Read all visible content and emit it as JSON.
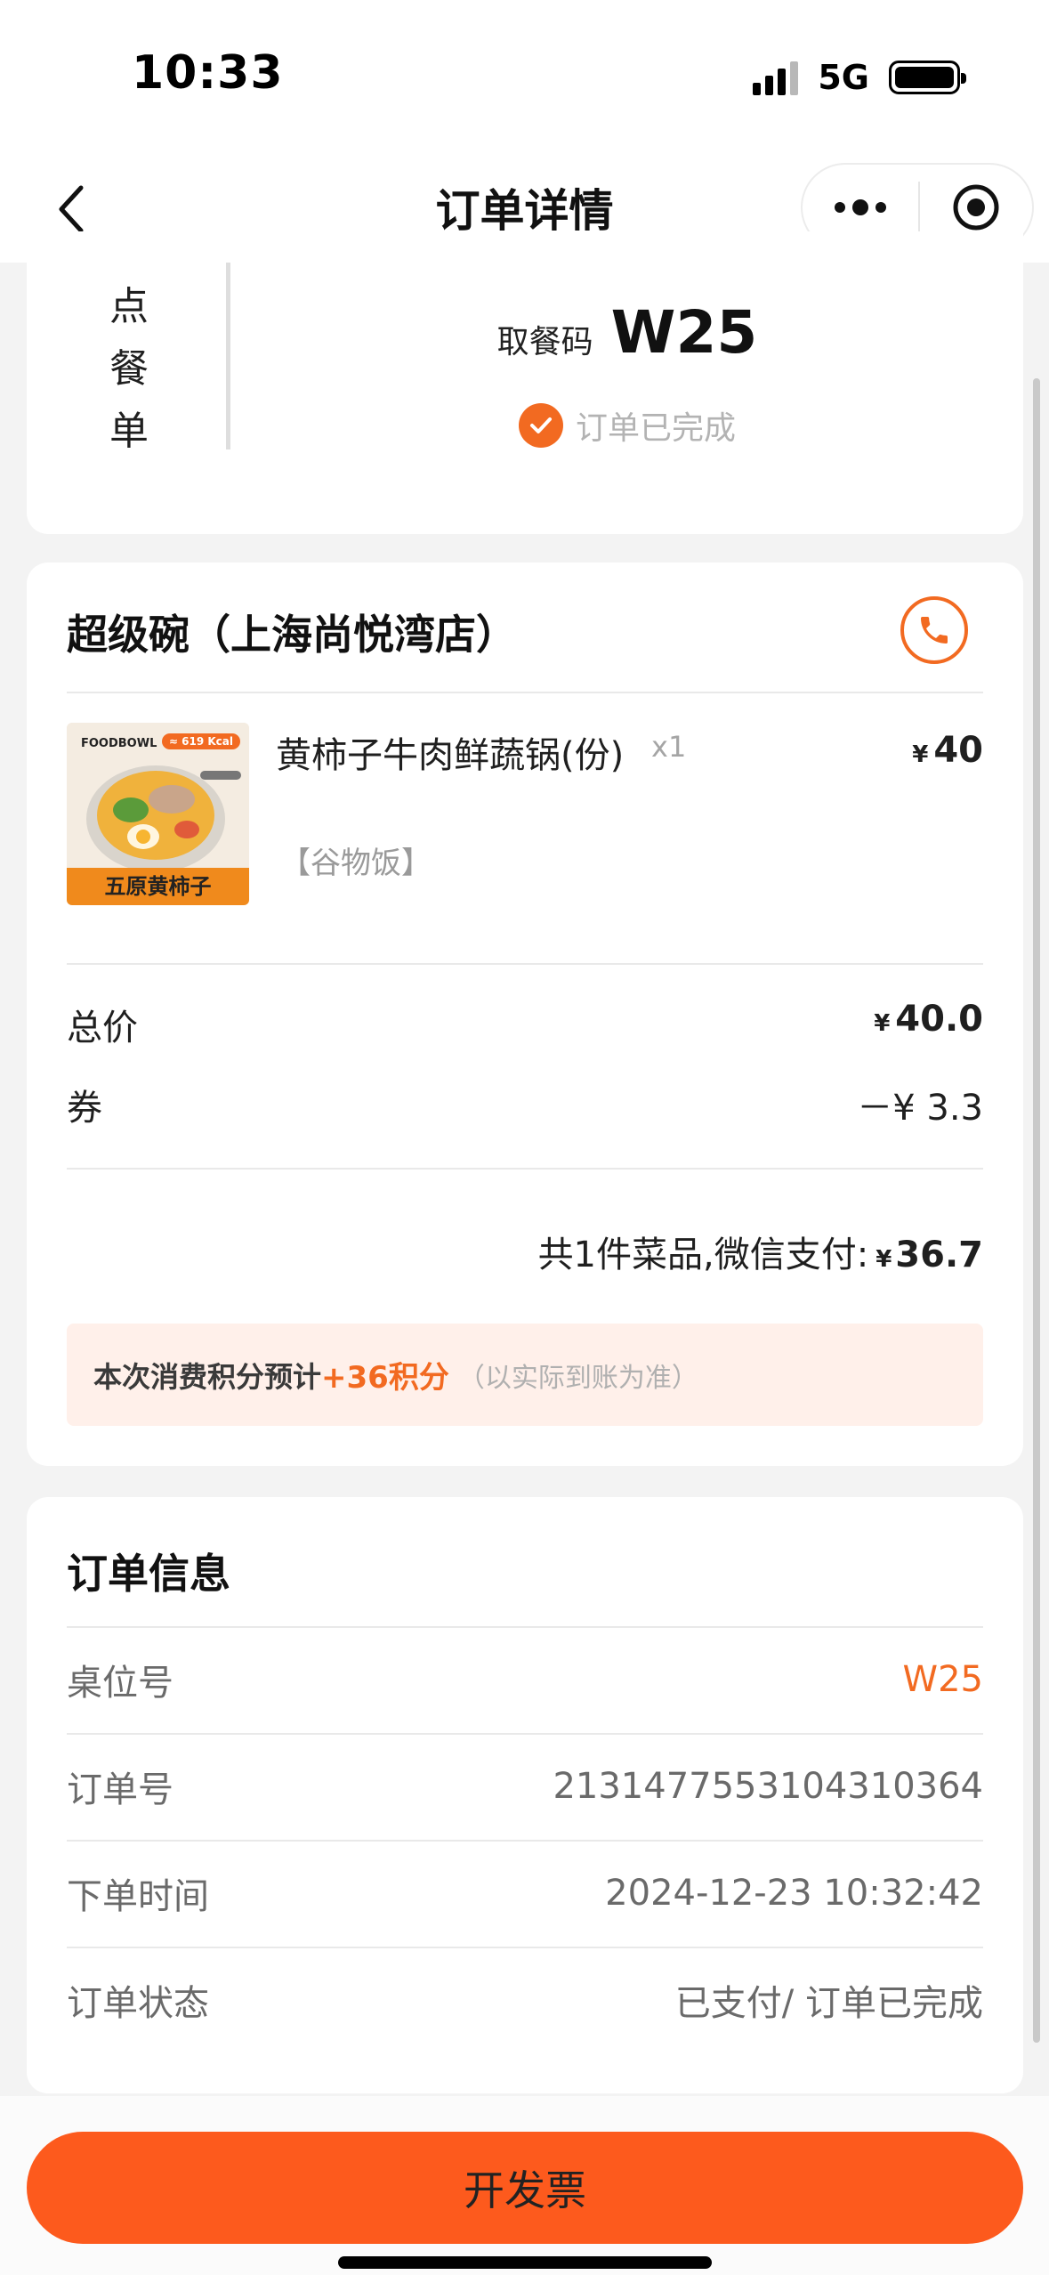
{
  "status_bar": {
    "time": "10:33",
    "network": "5G"
  },
  "nav": {
    "title": "订单详情"
  },
  "pickup": {
    "vertical_label": [
      "点",
      "餐",
      "单"
    ],
    "code_label": "取餐码",
    "code": "W25",
    "status": "订单已完成"
  },
  "order": {
    "store_name": "超级碗（上海尚悦湾店）",
    "item": {
      "image_brand": "FOODBOWL",
      "image_kcal": "≈ 619 Kcal",
      "image_banner": "五原黄柿子",
      "name": "黄柿子牛肉鲜蔬锅(份)",
      "tag": "【谷物饭】",
      "qty": "x1",
      "price_symbol": "¥",
      "price": "40"
    },
    "total_label": "总价",
    "total_symbol": "¥",
    "total_value": "40.0",
    "coupon_label": "券",
    "coupon_value": "－¥ 3.3",
    "summary_text": "共1件菜品,微信支付:",
    "summary_symbol": "¥",
    "summary_value": "36.7",
    "points_text": "本次消费积分预计",
    "points_value": "+36积分",
    "points_note": "（以实际到账为准）"
  },
  "info": {
    "title": "订单信息",
    "rows": [
      {
        "label": "桌位号",
        "value": "W25"
      },
      {
        "label": "订单号",
        "value": "2131477553104310364"
      },
      {
        "label": "下单时间",
        "value": "2024-12-23 10:32:42"
      },
      {
        "label": "订单状态",
        "value": "已支付/ 订单已完成"
      }
    ]
  },
  "bottom": {
    "invoice_label": "开发票"
  },
  "colors": {
    "accent": "#f26a21",
    "button": "#fd5a1d",
    "points_bg": "#fff0ea"
  },
  "icons": {
    "back": "chevron-left-icon",
    "more": "more-dots-icon",
    "target": "target-icon",
    "phone": "phone-icon",
    "check": "check-icon"
  }
}
